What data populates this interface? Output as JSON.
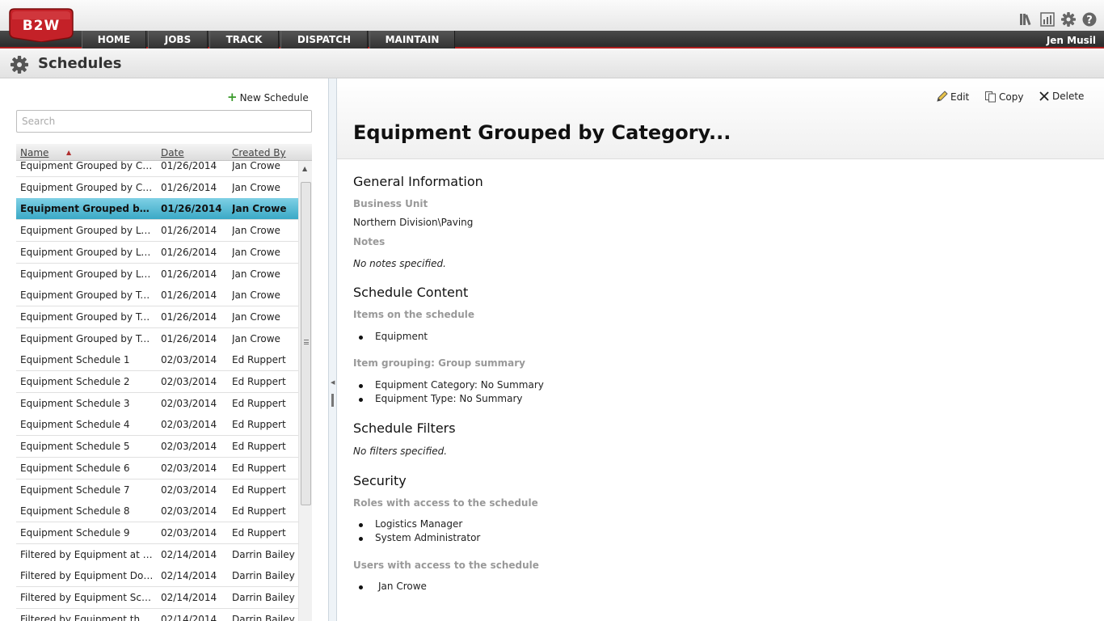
{
  "app": {
    "logo_text": "B2W",
    "nav": [
      "HOME",
      "JOBS",
      "TRACK",
      "DISPATCH",
      "MAINTAIN"
    ],
    "user": "Jen Musil",
    "icons": [
      "library-icon",
      "reports-icon",
      "settings-icon",
      "help-icon"
    ]
  },
  "page": {
    "title": "Schedules"
  },
  "left": {
    "new_label": "New Schedule",
    "search_placeholder": "Search",
    "columns": {
      "name": "Name",
      "date": "Date",
      "created_by": "Created By"
    },
    "rows": [
      {
        "name": "Equipment Grouped by Category Summary",
        "date": "01/26/2014",
        "by": "Jan Crowe"
      },
      {
        "name": "Equipment Grouped by Category Type",
        "date": "01/26/2014",
        "by": "Jan Crowe"
      },
      {
        "name": "Equipment Grouped by Category...",
        "date": "01/26/2014",
        "by": "Jan Crowe",
        "selected": true
      },
      {
        "name": "Equipment Grouped by Location",
        "date": "01/26/2014",
        "by": "Jan Crowe"
      },
      {
        "name": "Equipment Grouped by Location Summary",
        "date": "01/26/2014",
        "by": "Jan Crowe"
      },
      {
        "name": "Equipment Grouped by Location Type",
        "date": "01/26/2014",
        "by": "Jan Crowe"
      },
      {
        "name": "Equipment Grouped by Type",
        "date": "01/26/2014",
        "by": "Jan Crowe"
      },
      {
        "name": "Equipment Grouped by Type Summary",
        "date": "01/26/2014",
        "by": "Jan Crowe"
      },
      {
        "name": "Equipment Grouped by Type Category",
        "date": "01/26/2014",
        "by": "Jan Crowe"
      },
      {
        "name": "Equipment Schedule 1",
        "date": "02/03/2014",
        "by": "Ed Ruppert"
      },
      {
        "name": "Equipment Schedule 2",
        "date": "02/03/2014",
        "by": "Ed Ruppert"
      },
      {
        "name": "Equipment Schedule 3",
        "date": "02/03/2014",
        "by": "Ed Ruppert"
      },
      {
        "name": "Equipment Schedule 4",
        "date": "02/03/2014",
        "by": "Ed Ruppert"
      },
      {
        "name": "Equipment Schedule 5",
        "date": "02/03/2014",
        "by": "Ed Ruppert"
      },
      {
        "name": "Equipment Schedule 6",
        "date": "02/03/2014",
        "by": "Ed Ruppert"
      },
      {
        "name": "Equipment Schedule 7",
        "date": "02/03/2014",
        "by": "Ed Ruppert"
      },
      {
        "name": "Equipment Schedule 8",
        "date": "02/03/2014",
        "by": "Ed Ruppert"
      },
      {
        "name": "Equipment Schedule 9",
        "date": "02/03/2014",
        "by": "Ed Ruppert"
      },
      {
        "name": "Filtered by Equipment at Repair Shop",
        "date": "02/14/2014",
        "by": "Darrin Bailey"
      },
      {
        "name": "Filtered by Equipment Down Status",
        "date": "02/14/2014",
        "by": "Darrin Bailey"
      },
      {
        "name": "Filtered by Equipment Scheduled",
        "date": "02/14/2014",
        "by": "Darrin Bailey"
      },
      {
        "name": "Filtered by Equipment that is Idle",
        "date": "02/14/2014",
        "by": "Darrin Bailey"
      }
    ]
  },
  "detail": {
    "actions": {
      "edit": "Edit",
      "copy": "Copy",
      "delete": "Delete"
    },
    "title": "Equipment Grouped by Category...",
    "general": {
      "heading": "General Information",
      "bu_label": "Business Unit",
      "bu_value": "Northern Division\\Paving",
      "notes_label": "Notes",
      "notes_value": "No notes specified."
    },
    "content": {
      "heading": "Schedule Content",
      "items_label": "Items on the schedule",
      "items": [
        "Equipment"
      ],
      "grouping_label": "Item grouping: Group summary",
      "grouping": [
        "Equipment Category: No Summary",
        "Equipment Type: No Summary"
      ]
    },
    "filters": {
      "heading": "Schedule Filters",
      "value": "No filters specified."
    },
    "security": {
      "heading": "Security",
      "roles_label": "Roles with access to the schedule",
      "roles": [
        "Logistics Manager",
        "System Administrator"
      ],
      "users_label": "Users with access to the schedule",
      "users": [
        "Jan Crowe"
      ]
    }
  }
}
